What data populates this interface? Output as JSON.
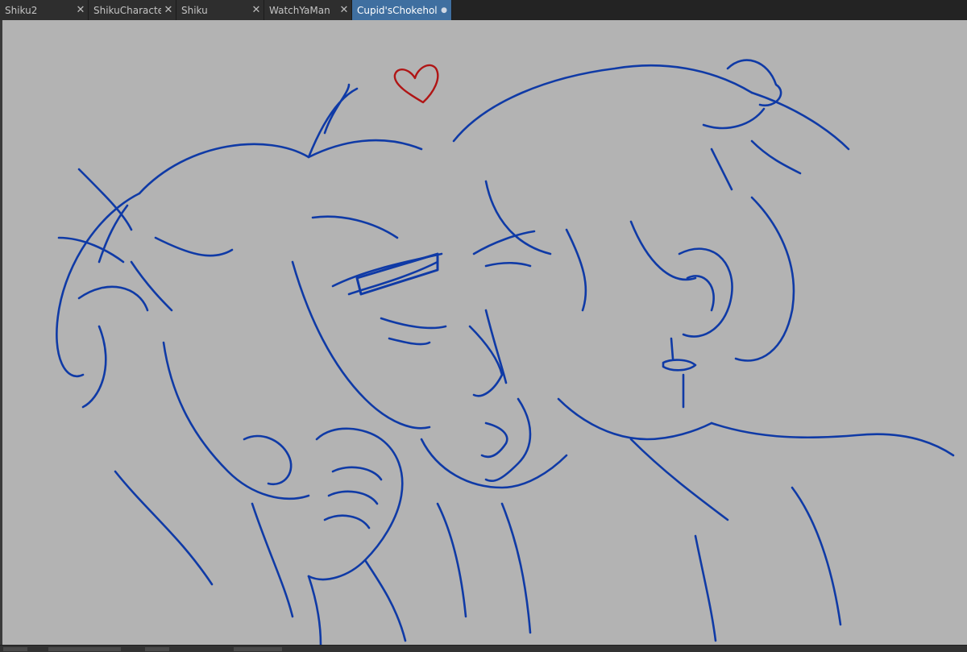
{
  "tabs": [
    {
      "label": "Shiku2",
      "close": "✕",
      "active": false
    },
    {
      "label": "ShikuCharacterS",
      "close": "✕",
      "active": false
    },
    {
      "label": "Shiku",
      "close": "✕",
      "active": false
    },
    {
      "label": "WatchYaMan",
      "close": "✕",
      "active": false
    },
    {
      "label": "Cupid'sChokehold*",
      "close": "●",
      "active": true
    }
  ],
  "colors": {
    "canvas_background": "#b3b3b3",
    "line_color": "#0f3aa6",
    "heart_color": "#b01515",
    "active_tab": "#3f6fa0"
  }
}
